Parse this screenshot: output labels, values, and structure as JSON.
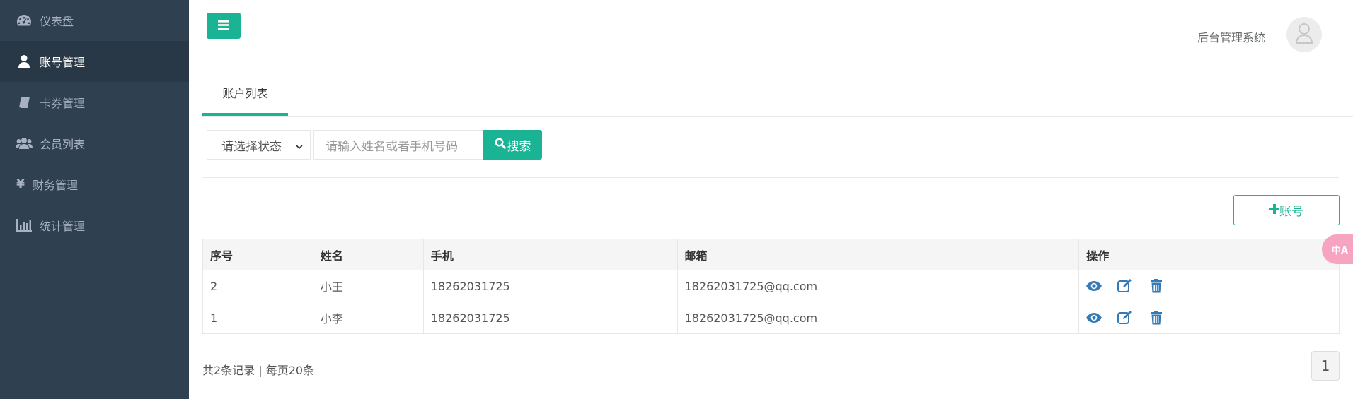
{
  "sidebar": {
    "items": [
      {
        "label": "仪表盘",
        "icon": "dashboard-icon",
        "active": false
      },
      {
        "label": "账号管理",
        "icon": "user-icon",
        "active": true
      },
      {
        "label": "卡券管理",
        "icon": "book-icon",
        "active": false
      },
      {
        "label": "会员列表",
        "icon": "users-icon",
        "active": false
      },
      {
        "label": "财务管理",
        "icon": "yen-icon",
        "active": false
      },
      {
        "label": "统计管理",
        "icon": "bar-chart-icon",
        "active": false
      }
    ]
  },
  "header": {
    "system_title": "后台管理系统"
  },
  "tabs": [
    {
      "label": "账户列表",
      "active": true
    }
  ],
  "filter": {
    "status_placeholder": "请选择状态",
    "search_placeholder": "请输入姓名或者手机号码",
    "search_label": "搜索"
  },
  "add_button_label": "账号",
  "table": {
    "headers": [
      "序号",
      "姓名",
      "手机",
      "邮箱",
      "操作"
    ],
    "rows": [
      {
        "id": "2",
        "name": "小王",
        "phone": "18262031725",
        "email": "18262031725@qq.com"
      },
      {
        "id": "1",
        "name": "小李",
        "phone": "18262031725",
        "email": "18262031725@qq.com"
      }
    ]
  },
  "footer": {
    "summary": "共2条记录 | 每页20条",
    "current_page": "1"
  },
  "translate_fab_label": "中A",
  "colors": {
    "accent": "#1ab394",
    "sidebar_bg": "#2f4050",
    "sidebar_active_bg": "#293846",
    "action_icon": "#337ab7"
  }
}
